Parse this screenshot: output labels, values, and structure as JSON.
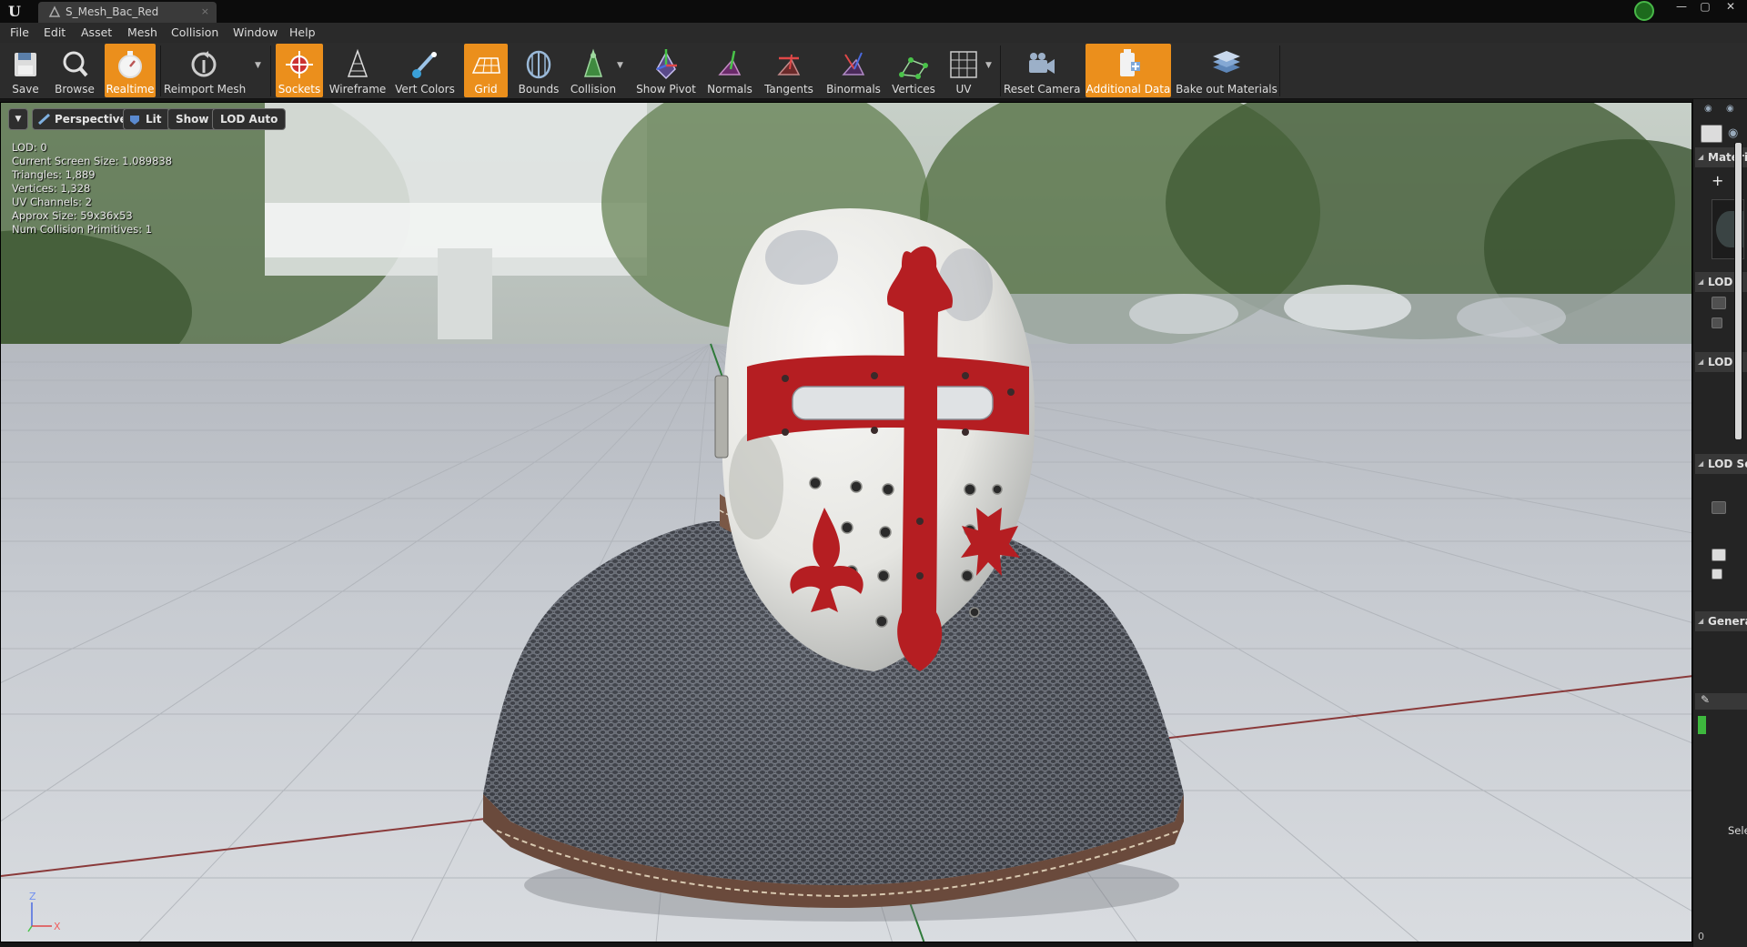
{
  "window": {
    "tab_title": "S_Mesh_Bac_Red",
    "tab_close": "×",
    "app_logo": "U",
    "controls": {
      "minimize": "—",
      "maximize": "▢",
      "close": "✕"
    }
  },
  "menubar": {
    "items": [
      "File",
      "Edit",
      "Asset",
      "Mesh",
      "Collision",
      "Window",
      "Help"
    ]
  },
  "toolbar": {
    "buttons": [
      {
        "label": "Save",
        "icon": "save-icon",
        "active": false
      },
      {
        "label": "Browse",
        "icon": "browse-icon",
        "active": false
      },
      {
        "label": "Realtime",
        "icon": "realtime-icon",
        "active": true
      },
      {
        "label": "Reimport Mesh",
        "icon": "reimport-icon",
        "active": false
      },
      {
        "label": "Sockets",
        "icon": "sockets-icon",
        "active": true
      },
      {
        "label": "Wireframe",
        "icon": "wireframe-icon",
        "active": false
      },
      {
        "label": "Vert Colors",
        "icon": "vert-colors-icon",
        "active": false
      },
      {
        "label": "Grid",
        "icon": "grid-icon",
        "active": true
      },
      {
        "label": "Bounds",
        "icon": "bounds-icon",
        "active": false
      },
      {
        "label": "Collision",
        "icon": "collision-icon",
        "active": false
      },
      {
        "label": "Show Pivot",
        "icon": "pivot-icon",
        "active": false
      },
      {
        "label": "Normals",
        "icon": "normals-icon",
        "active": false
      },
      {
        "label": "Tangents",
        "icon": "tangents-icon",
        "active": false
      },
      {
        "label": "Binormals",
        "icon": "binormals-icon",
        "active": false
      },
      {
        "label": "Vertices",
        "icon": "vertices-icon",
        "active": false
      },
      {
        "label": "UV",
        "icon": "uv-icon",
        "active": false
      },
      {
        "label": "Reset Camera",
        "icon": "camera-icon",
        "active": false
      },
      {
        "label": "Additional Data",
        "icon": "additional-data-icon",
        "active": true
      },
      {
        "label": "Bake out Materials",
        "icon": "bake-materials-icon",
        "active": false
      }
    ]
  },
  "viewport": {
    "options": {
      "dropdown": "▼",
      "perspective": "Perspective",
      "lit": "Lit",
      "show": "Show",
      "lod": "LOD Auto"
    },
    "stats": [
      "LOD:  0",
      "Current Screen Size:  1.089838",
      "Triangles:  1,889",
      "Vertices:  1,328",
      "UV Channels:  2",
      "Approx Size: 59x36x53",
      "Num Collision Primitives:  1"
    ],
    "axis": {
      "z": "Z",
      "x": "X"
    }
  },
  "right_panel": {
    "sections": [
      "Materi",
      "LOD",
      "LOD",
      "LOD Se",
      "Genera"
    ],
    "add_button": "+",
    "select_label": "Select",
    "bottom_value": "0"
  },
  "colors": {
    "accent": "#eb8f1c",
    "helmet_red": "#b51e22",
    "helmet_white": "#e9e9e6",
    "grid_floor": "#c7cbd1"
  }
}
